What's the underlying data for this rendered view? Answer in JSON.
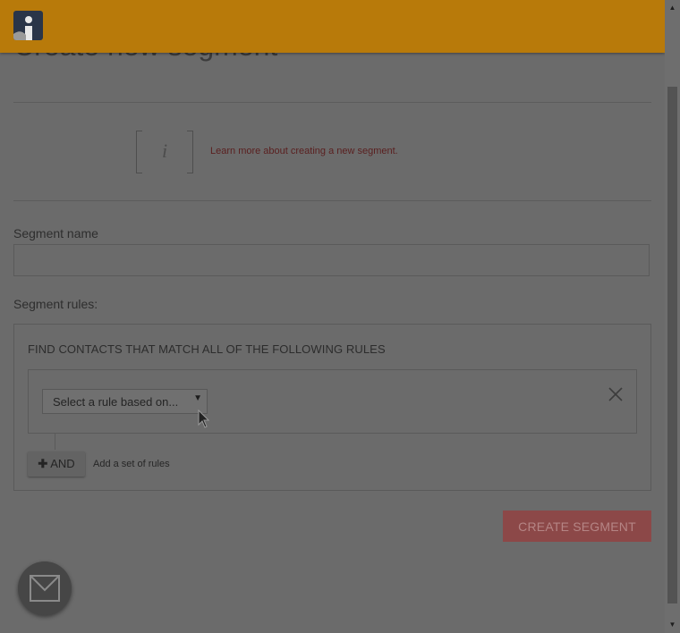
{
  "page": {
    "title": "Create new segment"
  },
  "info": {
    "icon": "info-icon",
    "glyph": "i",
    "link_text": "Learn more about creating a new segment."
  },
  "form": {
    "segment_name_label": "Segment name",
    "segment_name_value": "",
    "segment_rules_label": "Segment rules:"
  },
  "rules": {
    "heading": "FIND CONTACTS THAT MATCH ALL OF THE FOLLOWING RULES",
    "select_placeholder": "Select a rule based on...",
    "and_button_label": "AND",
    "add_set_text": "Add a set of rules"
  },
  "actions": {
    "create_label": "CREATE SEGMENT"
  },
  "colors": {
    "header": "#b87a0a",
    "logo_bg": "#2a3548",
    "create_button": "#8c4848",
    "link": "#5a1f1f"
  },
  "icons": {
    "logo": "info-logo-icon",
    "remove_rule": "close-icon",
    "select_arrow": "caret-down-icon",
    "and_plus": "plus-icon",
    "chat": "envelope-icon",
    "cursor": "mouse-pointer-icon"
  }
}
